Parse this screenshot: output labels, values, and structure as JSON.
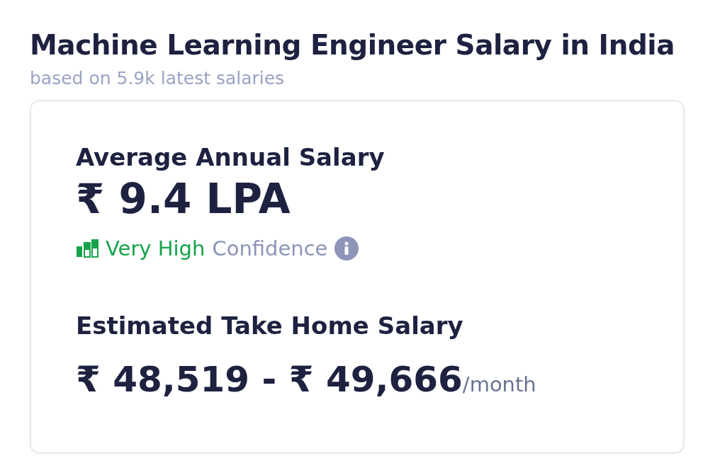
{
  "title": "Machine Learning Engineer Salary in India",
  "subtitle": "based on 5.9k latest salaries",
  "average": {
    "label": "Average Annual Salary",
    "value": "₹ 9.4 LPA",
    "confidence": {
      "level_text": "Very High",
      "label": "Confidence"
    }
  },
  "take_home": {
    "label": "Estimated Take Home Salary",
    "value": "₹ 48,519 - ₹ 49,666",
    "unit": "/month"
  }
}
